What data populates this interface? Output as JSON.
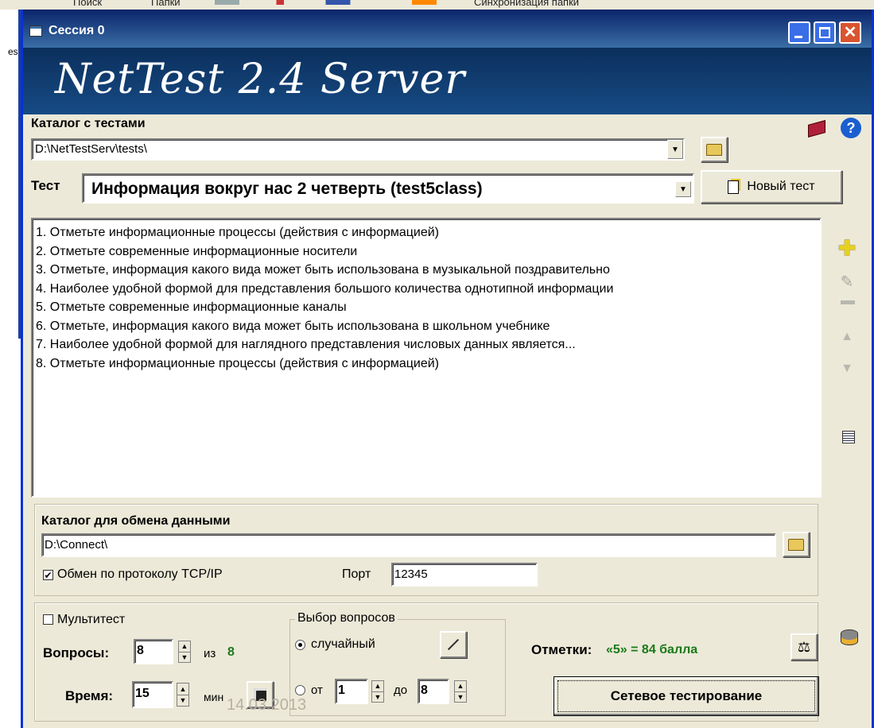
{
  "background_app": {
    "toolbar_items": [
      "Поиск",
      "Папки",
      "Синхронизация папки"
    ],
    "left_fragment": "es"
  },
  "window": {
    "title": "Сессия 0",
    "banner": "NetTest 2.4 Server"
  },
  "catalog": {
    "label": "Каталог с тестами",
    "path": "D:\\NetTestServ\\tests\\"
  },
  "test": {
    "label": "Тест",
    "selected": "Информация вокруг нас 2 четверть (test5class)",
    "new_test_label": "Новый тест"
  },
  "questions": [
    "1. Отметьте информационные процессы (действия с информацией)",
    "2. Отметьте современные информационные носители",
    "3. Отметьте, информация какого вида может быть использована в музыкальной поздравительно",
    "4. Наиболее удобной формой для представления большого количества однотипной информации",
    "5. Отметьте современные информационные каналы",
    "6. Отметьте, информация какого вида может быть использована в школьном учебнике",
    "7. Наиболее удобной формой для наглядного представления числовых данных является...",
    "8. Отметьте информационные процессы (действия с информацией)"
  ],
  "exchange": {
    "label": "Каталог для обмена данными",
    "path": "D:\\Connect\\",
    "tcp_label": "Обмен по протоколу TCP/IP",
    "tcp_checked": true,
    "port_label": "Порт",
    "port_value": "12345"
  },
  "settings": {
    "multitest_label": "Мультитест",
    "multitest_checked": false,
    "questions_label": "Вопросы:",
    "questions_value": "8",
    "of_label": "из",
    "of_value": "8",
    "time_label": "Время:",
    "time_value": "15",
    "min_label": "мин",
    "selection_group_label": "Выбор вопросов",
    "random_label": "случайный",
    "from_label": "от",
    "from_value": "1",
    "to_label": "до",
    "to_value": "8",
    "selected_mode": "random",
    "grades_label": "Отметки:",
    "grades_value": "«5» = 84 балла",
    "start_button": "Сетевое тестирование"
  },
  "watermark_date": "14.03.2013",
  "colors": {
    "title_bar": "#0a246a",
    "banner_bg": "#0b2f5c",
    "window_bg": "#ece9d8",
    "green_text": "#1a7a1a",
    "close_button": "#d9542f"
  },
  "icons": [
    "book-icon",
    "help-icon",
    "folder-icon",
    "new-doc-icon",
    "add-icon",
    "edit-icon",
    "remove-icon",
    "up-arrow-icon",
    "down-arrow-icon",
    "list-icon",
    "wand-icon",
    "save-icon",
    "scales-icon",
    "database-icon"
  ]
}
